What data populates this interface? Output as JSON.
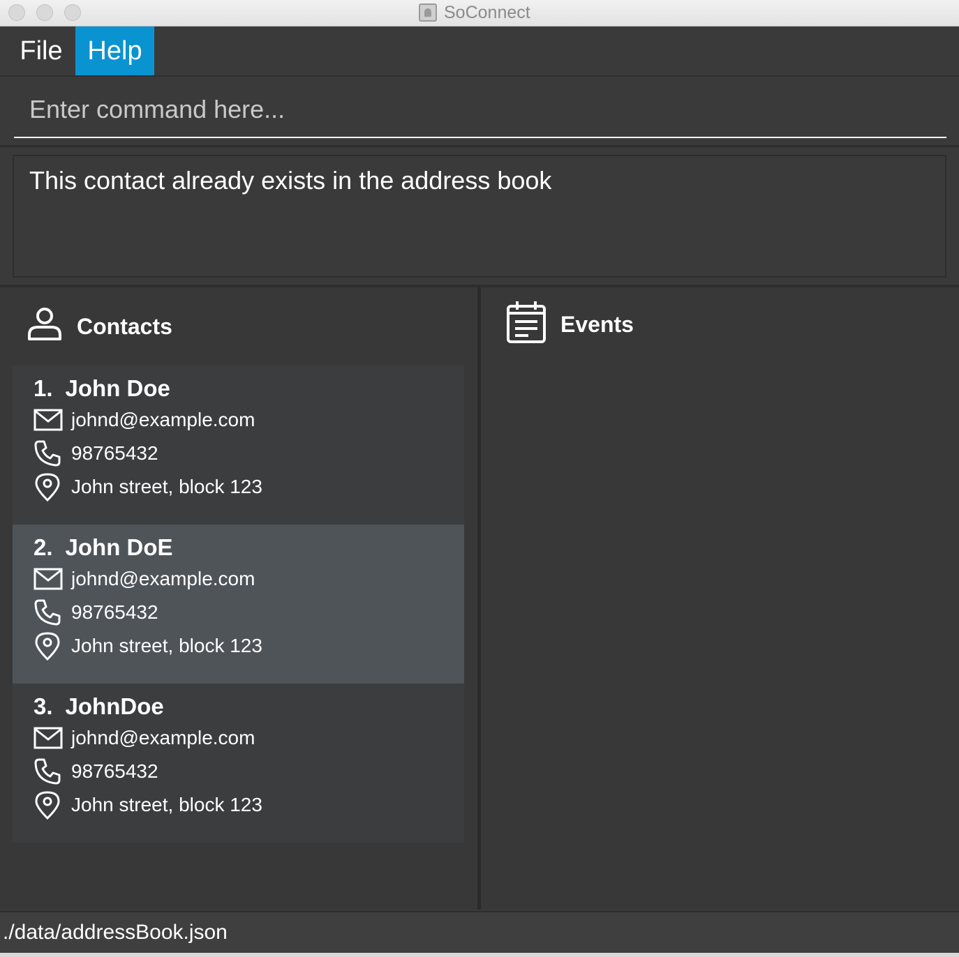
{
  "window": {
    "title": "SoConnect"
  },
  "menu": {
    "items": [
      {
        "label": "File"
      },
      {
        "label": "Help"
      }
    ]
  },
  "command": {
    "placeholder": "Enter command here...",
    "value": ""
  },
  "result": {
    "message": "This contact already exists in the address book"
  },
  "contacts": {
    "title": "Contacts",
    "items": [
      {
        "index": "1.",
        "name": "John Doe",
        "email": "johnd@example.com",
        "phone": "98765432",
        "address": "John street, block 123"
      },
      {
        "index": "2.",
        "name": "John DoE",
        "email": "johnd@example.com",
        "phone": "98765432",
        "address": "John street, block 123"
      },
      {
        "index": "3.",
        "name": "JohnDoe",
        "email": "johnd@example.com",
        "phone": "98765432",
        "address": "John street, block 123"
      }
    ]
  },
  "events": {
    "title": "Events"
  },
  "status": {
    "path": "./data/addressBook.json"
  },
  "colors": {
    "accent": "#0a93d1",
    "background": "#3a3a3a",
    "selected_card": "#4f5458"
  }
}
